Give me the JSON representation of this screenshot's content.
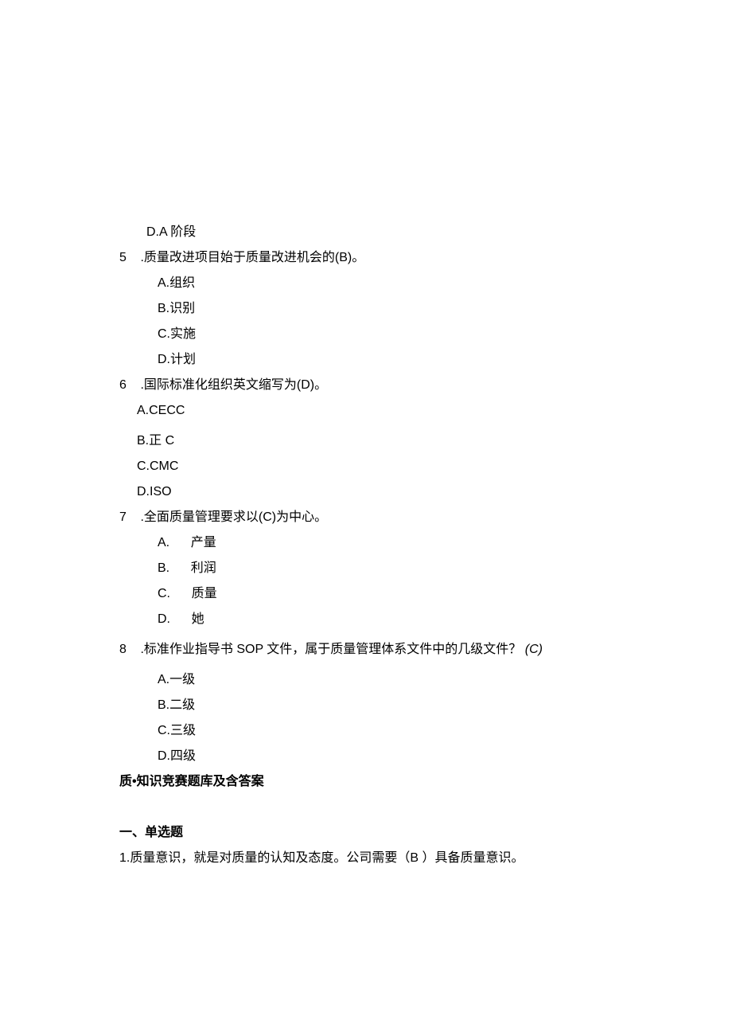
{
  "q4": {
    "optD": "D.A 阶段"
  },
  "q5": {
    "num": "5",
    "stem": " .质量改进项目始于质量改进机会的(B)。",
    "A": "A.组织",
    "B": "B.识别",
    "C": "C.实施",
    "D": "D.计划"
  },
  "q6": {
    "num": "6",
    "stem": " .国际标准化组织英文缩写为(D)。",
    "A": "A.CECC",
    "B": "B.正 C",
    "C": "C.CMC",
    "D": "D.ISO"
  },
  "q7": {
    "num": "7",
    "stem": " .全面质量管理要求以(C)为中心。",
    "A": "A.      产量",
    "B": "B.      利润",
    "C": "C.      质量",
    "D": "D.      她"
  },
  "q8": {
    "num": "8",
    "stem_a": " .标准作业指导书 SOP 文件，属于质量管理体系文件中的几级文件？ ",
    "stem_b": "(C)",
    "A": "A.一级",
    "B": "B.二级",
    "C": "C.三级",
    "D": "D.四级"
  },
  "subtitle": "质•知识竞赛题库及含答案",
  "section": "一、单选题",
  "qA1": "1.质量意识，就是对质量的认知及态度。公司需要（B ）具备质量意识。"
}
